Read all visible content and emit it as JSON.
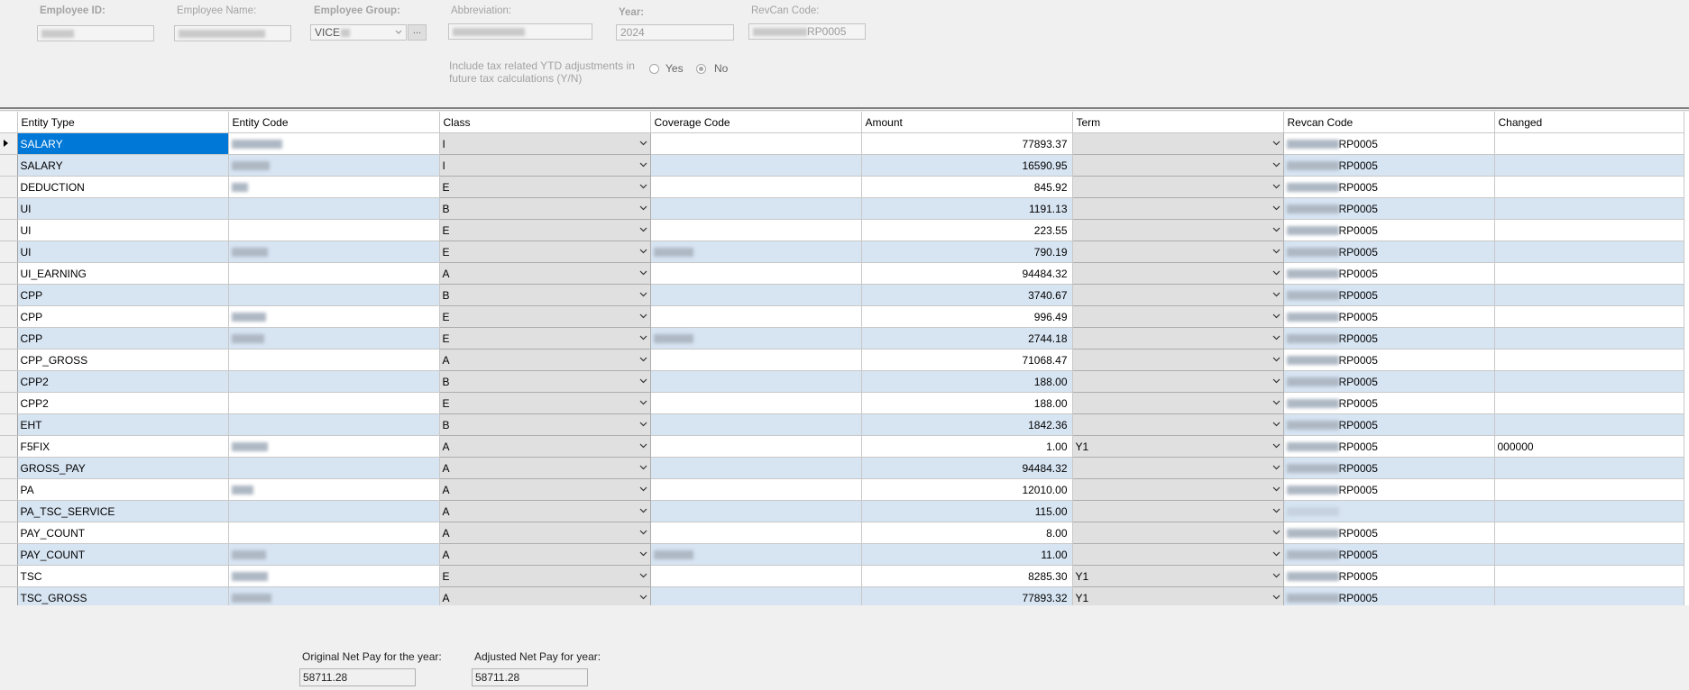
{
  "header": {
    "employee_id": {
      "label": "Employee ID:",
      "value": ""
    },
    "employee_name": {
      "label": "Employee Name:",
      "value": ""
    },
    "employee_group": {
      "label": "Employee Group:",
      "value": "VICE",
      "button_label": "..."
    },
    "abbreviation": {
      "label": "Abbreviation:",
      "value": ""
    },
    "year": {
      "label": "Year:",
      "value": "2024"
    },
    "revcan_code": {
      "label": "RevCan Code:",
      "value": "RP0005"
    },
    "tax_option": {
      "text": "Include tax related YTD adjustments in future tax calculations (Y/N)",
      "yes_label": "Yes",
      "no_label": "No",
      "selected": "No"
    }
  },
  "grid": {
    "columns": [
      "Entity Type",
      "Entity Code",
      "Class",
      "Coverage Code",
      "Amount",
      "Term",
      "Revcan Code",
      "Changed"
    ],
    "rows": [
      {
        "entity_type": "SALARY",
        "entity_code": "",
        "class": "I",
        "coverage_code": "",
        "amount": "77893.37",
        "term": "",
        "revcan_code": "RP0005",
        "changed": ""
      },
      {
        "entity_type": "SALARY",
        "entity_code": "",
        "class": "I",
        "coverage_code": "",
        "amount": "16590.95",
        "term": "",
        "revcan_code": "RP0005",
        "changed": ""
      },
      {
        "entity_type": "DEDUCTION",
        "entity_code": "",
        "class": "E",
        "coverage_code": "",
        "amount": "845.92",
        "term": "",
        "revcan_code": "RP0005",
        "changed": ""
      },
      {
        "entity_type": "UI",
        "entity_code": "",
        "class": "B",
        "coverage_code": "",
        "amount": "1191.13",
        "term": "",
        "revcan_code": "RP0005",
        "changed": ""
      },
      {
        "entity_type": "UI",
        "entity_code": "",
        "class": "E",
        "coverage_code": "",
        "amount": "223.55",
        "term": "",
        "revcan_code": "RP0005",
        "changed": ""
      },
      {
        "entity_type": "UI",
        "entity_code": "",
        "class": "E",
        "coverage_code": "",
        "amount": "790.19",
        "term": "",
        "revcan_code": "RP0005",
        "changed": ""
      },
      {
        "entity_type": "UI_EARNING",
        "entity_code": "",
        "class": "A",
        "coverage_code": "",
        "amount": "94484.32",
        "term": "",
        "revcan_code": "RP0005",
        "changed": ""
      },
      {
        "entity_type": "CPP",
        "entity_code": "",
        "class": "B",
        "coverage_code": "",
        "amount": "3740.67",
        "term": "",
        "revcan_code": "RP0005",
        "changed": ""
      },
      {
        "entity_type": "CPP",
        "entity_code": "",
        "class": "E",
        "coverage_code": "",
        "amount": "996.49",
        "term": "",
        "revcan_code": "RP0005",
        "changed": ""
      },
      {
        "entity_type": "CPP",
        "entity_code": "",
        "class": "E",
        "coverage_code": "",
        "amount": "2744.18",
        "term": "",
        "revcan_code": "RP0005",
        "changed": ""
      },
      {
        "entity_type": "CPP_GROSS",
        "entity_code": "",
        "class": "A",
        "coverage_code": "",
        "amount": "71068.47",
        "term": "",
        "revcan_code": "RP0005",
        "changed": ""
      },
      {
        "entity_type": "CPP2",
        "entity_code": "",
        "class": "B",
        "coverage_code": "",
        "amount": "188.00",
        "term": "",
        "revcan_code": "RP0005",
        "changed": ""
      },
      {
        "entity_type": "CPP2",
        "entity_code": "",
        "class": "E",
        "coverage_code": "",
        "amount": "188.00",
        "term": "",
        "revcan_code": "RP0005",
        "changed": ""
      },
      {
        "entity_type": "EHT",
        "entity_code": "",
        "class": "B",
        "coverage_code": "",
        "amount": "1842.36",
        "term": "",
        "revcan_code": "RP0005",
        "changed": ""
      },
      {
        "entity_type": "F5FIX",
        "entity_code": "",
        "class": "A",
        "coverage_code": "",
        "amount": "1.00",
        "term": "Y1",
        "revcan_code": "RP0005",
        "changed": "000000"
      },
      {
        "entity_type": "GROSS_PAY",
        "entity_code": "",
        "class": "A",
        "coverage_code": "",
        "amount": "94484.32",
        "term": "",
        "revcan_code": "RP0005",
        "changed": ""
      },
      {
        "entity_type": "PA",
        "entity_code": "",
        "class": "A",
        "coverage_code": "",
        "amount": "12010.00",
        "term": "",
        "revcan_code": "RP0005",
        "changed": ""
      },
      {
        "entity_type": "PA_TSC_SERVICE",
        "entity_code": "",
        "class": "A",
        "coverage_code": "",
        "amount": "115.00",
        "term": "",
        "revcan_code": "",
        "changed": ""
      },
      {
        "entity_type": "PAY_COUNT",
        "entity_code": "",
        "class": "A",
        "coverage_code": "",
        "amount": "8.00",
        "term": "",
        "revcan_code": "RP0005",
        "changed": ""
      },
      {
        "entity_type": "PAY_COUNT",
        "entity_code": "",
        "class": "A",
        "coverage_code": "",
        "amount": "11.00",
        "term": "",
        "revcan_code": "RP0005",
        "changed": ""
      },
      {
        "entity_type": "TSC",
        "entity_code": "",
        "class": "E",
        "coverage_code": "",
        "amount": "8285.30",
        "term": "Y1",
        "revcan_code": "RP0005",
        "changed": ""
      },
      {
        "entity_type": "TSC_GROSS",
        "entity_code": "",
        "class": "A",
        "coverage_code": "",
        "amount": "77893.32",
        "term": "Y1",
        "revcan_code": "RP0005",
        "changed": ""
      }
    ]
  },
  "footer": {
    "original_net_pay": {
      "label": "Original Net Pay for the year:",
      "value": "58711.28"
    },
    "adjusted_net_pay": {
      "label": "Adjusted Net Pay for year:",
      "value": "58711.28"
    }
  },
  "colors": {
    "selection": "#0078d7",
    "alt_row": "#d7e4f2",
    "combo_bg": "#e0e0e0"
  }
}
